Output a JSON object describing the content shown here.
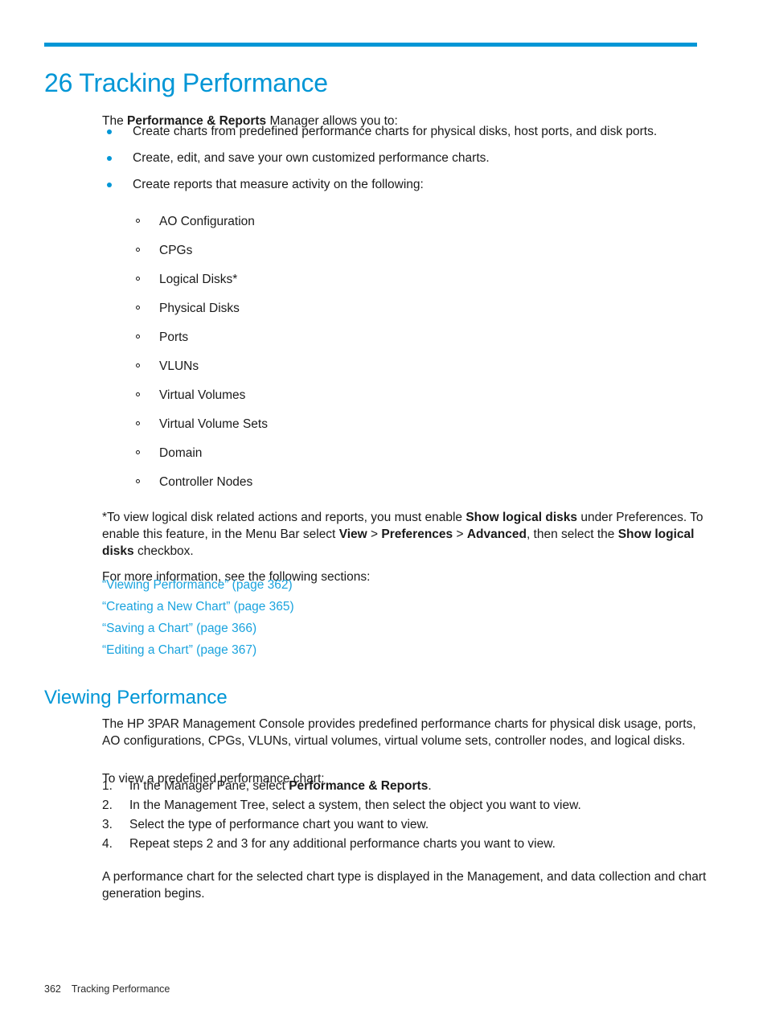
{
  "document": {
    "accent_color": "#0096d6",
    "link_color": "#1aa3de",
    "text_color": "#1a1a1a"
  },
  "chapter": {
    "number": "26",
    "title": "26 Tracking Performance"
  },
  "intro": {
    "lead_before": "The ",
    "lead_bold": "Performance & Reports",
    "lead_after": " Manager allows you to:"
  },
  "bullets": [
    "Create charts from predefined performance charts for physical disks, host ports, and disk ports.",
    "Create, edit, and save your own customized performance charts.",
    "Create reports that measure activity on the following:"
  ],
  "report_types": [
    "AO Configuration",
    "CPGs",
    "Logical Disks*",
    "Physical Disks",
    "Ports",
    "VLUNs",
    "Virtual Volumes",
    "Virtual Volume Sets",
    "Domain",
    "Controller Nodes"
  ],
  "footnote": {
    "part1": "*To view logical disk related actions and reports, you must enable ",
    "bold1": "Show logical disks",
    "part2": " under Preferences. To enable this feature, in the Menu Bar select ",
    "bold2": "View",
    "sep1": " > ",
    "bold3": "Preferences",
    "sep2": " > ",
    "bold4": "Advanced",
    "part3": ", then select the ",
    "bold5": "Show logical disks",
    "part4": " checkbox."
  },
  "more_info": {
    "lead": "For more information, see the following sections:",
    "links": [
      "“Viewing Performance” (page 362)",
      "“Creating a New Chart” (page 365)",
      "“Saving a Chart” (page 366)",
      "“Editing a Chart” (page 367)"
    ]
  },
  "section": {
    "heading": "Viewing Performance",
    "para_1": "The HP 3PAR Management Console provides predefined performance charts for physical disk usage, ports, AO configurations, CPGs, VLUNs, virtual volumes, virtual volume sets, controller nodes, and logical disks.",
    "para_2": "To view a predefined performance chart:",
    "steps": [
      {
        "num": "1.",
        "before": "In the Manager Pane, select ",
        "bold": "Performance & Reports",
        "after": "."
      },
      {
        "num": "2.",
        "before": "In the Management Tree, select a system, then select the object you want to view.",
        "bold": "",
        "after": ""
      },
      {
        "num": "3.",
        "before": "Select the type of performance chart you want to view.",
        "bold": "",
        "after": ""
      },
      {
        "num": "4.",
        "before": "Repeat steps 2 and 3 for any additional performance charts you want to view.",
        "bold": "",
        "after": ""
      }
    ],
    "closing": "A performance chart for the selected chart type is displayed in the Management, and data collection and chart generation begins."
  },
  "footer": {
    "page_number": "362",
    "chapter_name": "Tracking Performance"
  }
}
